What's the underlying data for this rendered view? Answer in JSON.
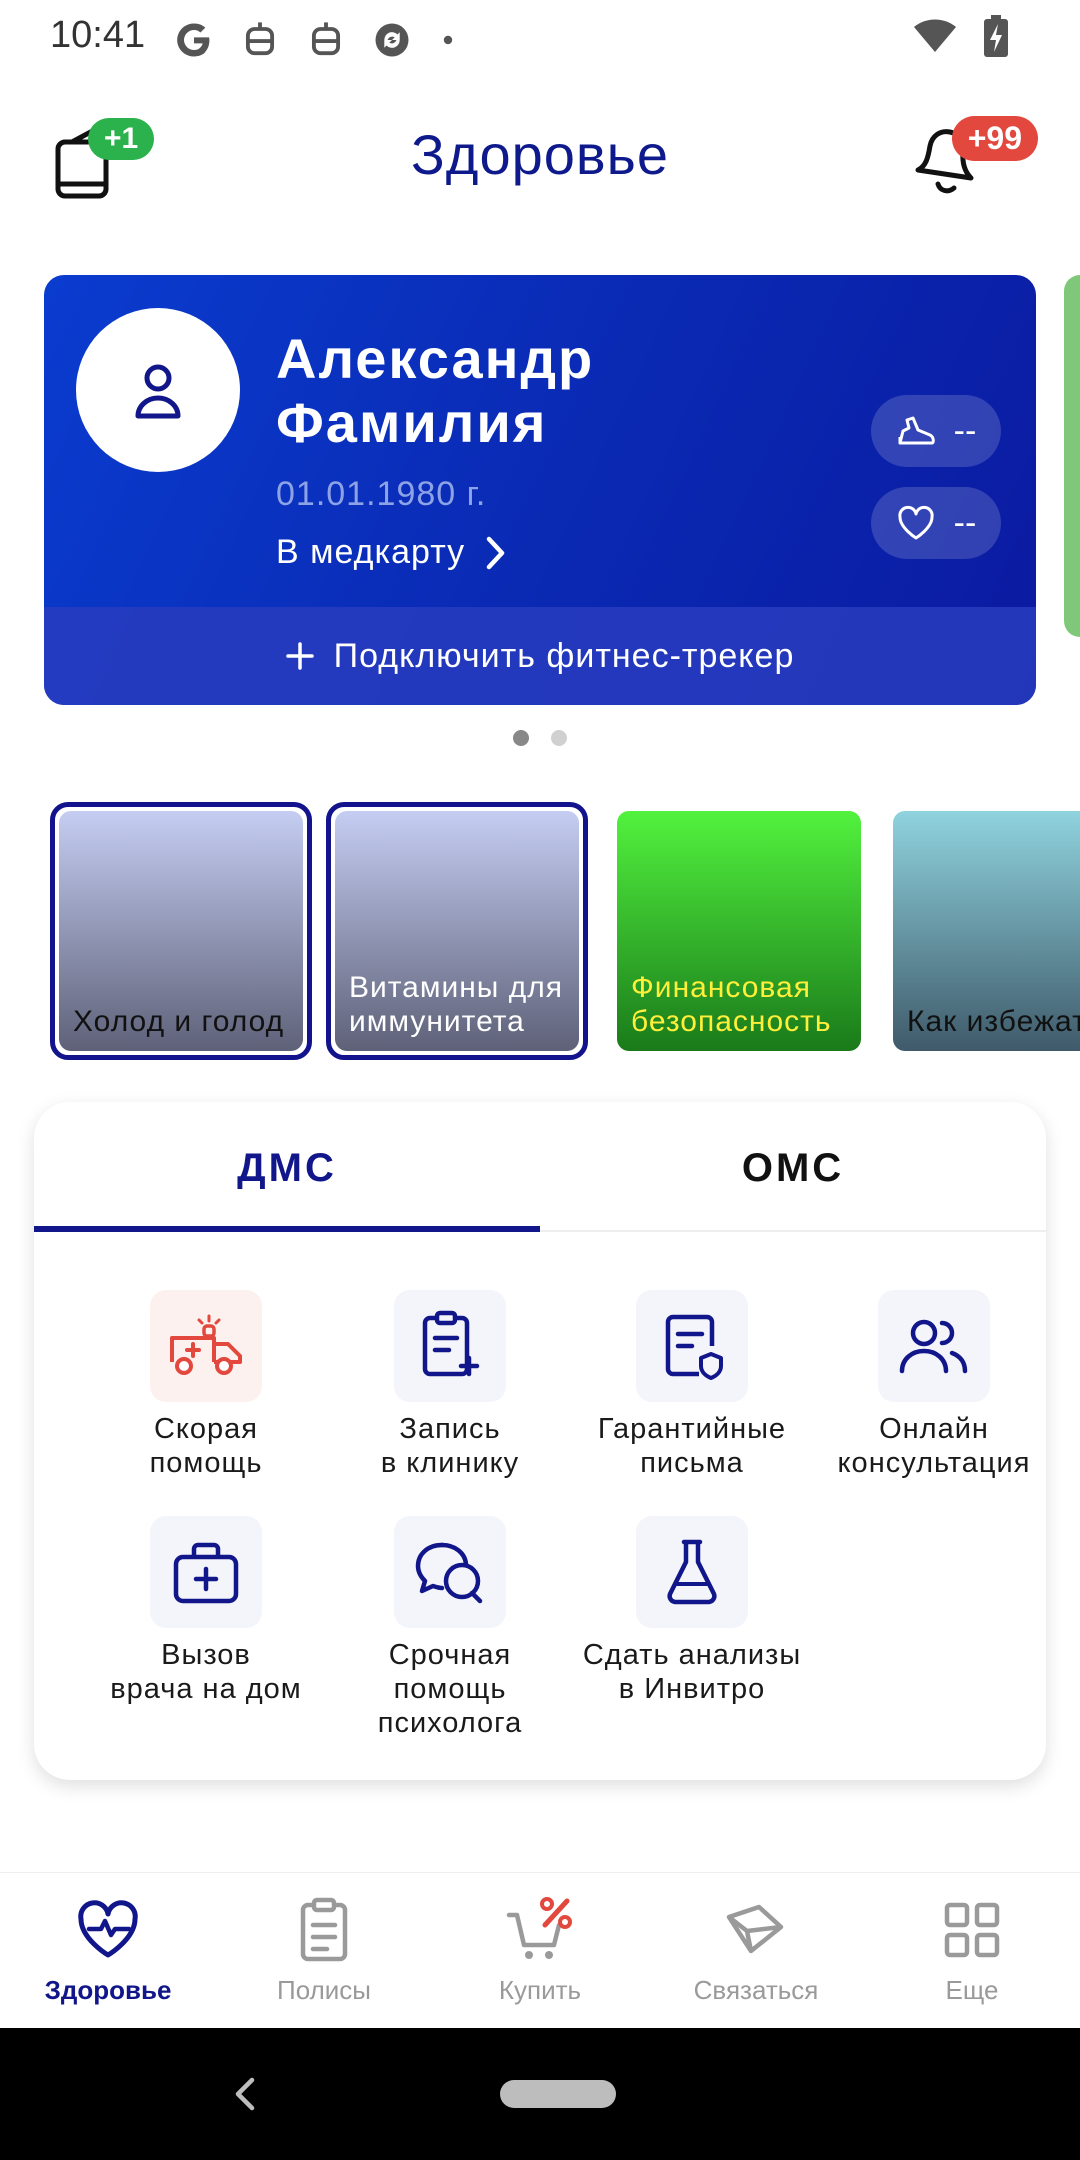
{
  "status": {
    "time": "10:41"
  },
  "header": {
    "title": "Здоровье",
    "policy_badge": "+1",
    "notifications_badge": "+99"
  },
  "profile": {
    "name_first": "Александр",
    "name_last": "Фамилия",
    "dob": "01.01.1980 г.",
    "medcard_link": "В медкарту",
    "steps_value": "--",
    "pulse_value": "--",
    "connect_tracker": "Подключить фитнес-трекер"
  },
  "carousel": {
    "pages": 2,
    "active_page": 1
  },
  "stories": [
    {
      "title": "Холод и голод",
      "seen": true
    },
    {
      "title": "Витамины для иммунитета",
      "seen": true
    },
    {
      "title": "Финансовая безопасность",
      "seen": false
    },
    {
      "title": "Как избежать обморожения",
      "seen": false
    }
  ],
  "tabs": {
    "dms": "ДМС",
    "oms": "ОМС",
    "active": "dms"
  },
  "services": [
    {
      "label_line1": "Скорая",
      "label_line2": "помощь",
      "icon": "ambulance-icon"
    },
    {
      "label_line1": "Запись",
      "label_line2": "в клинику",
      "icon": "clipboard-plus-icon"
    },
    {
      "label_line1": "Гарантийные",
      "label_line2": "письма",
      "icon": "document-shield-icon"
    },
    {
      "label_line1": "Онлайн",
      "label_line2": "консультация",
      "icon": "people-icon"
    },
    {
      "label_line1": "Вызов",
      "label_line2": "врача на дом",
      "icon": "medical-bag-icon"
    },
    {
      "label_line1": "Срочная",
      "label_line2": "помощь",
      "label_line3": "психолога",
      "icon": "chat-bubbles-icon"
    },
    {
      "label_line1": "Сдать анализы",
      "label_line2": "в Инвитро",
      "icon": "flask-icon"
    }
  ],
  "bottom_nav": [
    {
      "label": "Здоровье",
      "icon": "heart-pulse-icon",
      "active": true
    },
    {
      "label": "Полисы",
      "icon": "clipboard-icon",
      "active": false
    },
    {
      "label": "Купить",
      "icon": "cart-percent-icon",
      "active": false
    },
    {
      "label": "Связаться",
      "icon": "envelope-icon",
      "active": false
    },
    {
      "label": "Еще",
      "icon": "grid-icon",
      "active": false
    }
  ],
  "colors": {
    "brand": "#11168a",
    "card_gradient_start": "#0a3ccf",
    "card_gradient_end": "#0b1aa0",
    "badge_green": "#2bb24c",
    "badge_red": "#e2483d",
    "ambulance_accent": "#e2483d"
  }
}
